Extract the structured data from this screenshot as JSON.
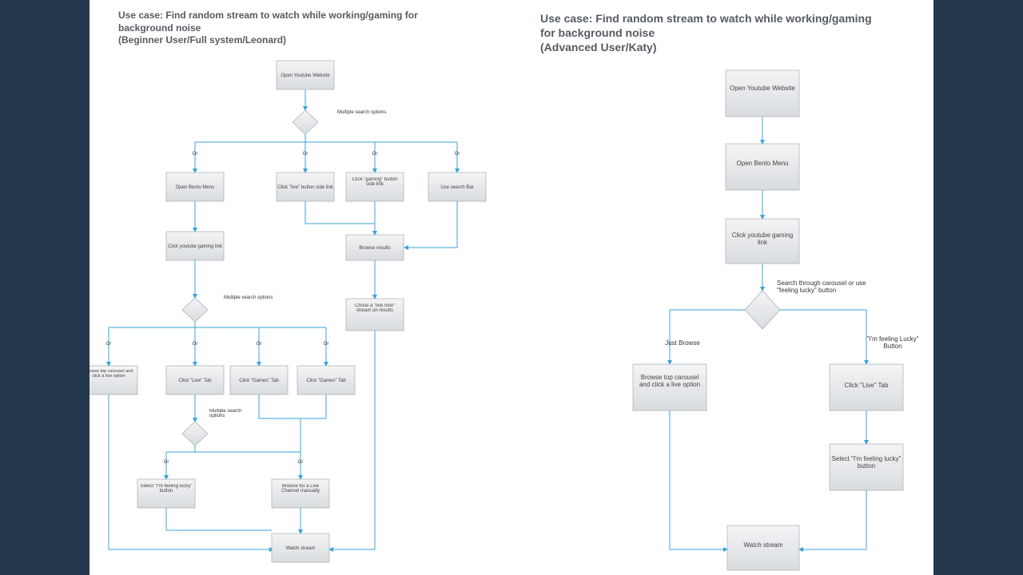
{
  "left": {
    "title": "Use case: Find random stream to watch while working/gaming for background noise\n(Beginner User/Full system/Leonard)",
    "nodes": {
      "n1": "Open Youtube Website",
      "dec1_label": "Multiple search options",
      "or": "Or",
      "b1": "Open Bento Menu",
      "b2": "Click \"live\" button side link",
      "b3": "Click \"gaming\" button side link",
      "b4": "Use search Bar",
      "n2": "Click youtube gaming link",
      "n3": "Browse results",
      "n4": "Chose a \"live now\" stream on results",
      "dec2_label": "Multiple search options",
      "c1": "Browse top carousel and click a live option",
      "c2": "Click \"Live\" Tab",
      "c3": "Click \"Games\" Tab",
      "c4": "Click \"Games\" Tab",
      "dec3_label": "Multiple search options",
      "d1": "Select \"I'm feeling lucky\" button",
      "d2": "Browse for a Live Channel manually",
      "nfinal": "Watch stream"
    }
  },
  "right": {
    "title": "Use case: Find random stream to watch while working/gaming for background noise\n(Advanced User/Katy)",
    "nodes": {
      "r1": "Open Youtube Website",
      "r2": "Open Bento Menu",
      "r3": "Click youtube gaming link",
      "dec_label": "Search through carousel or use \"feeling lucky\" button",
      "br1": "Just Browse",
      "br2": "\"I'm feeling Lucky\" Button",
      "r4": "Browse top carousel and click a live option",
      "r5": "Click \"Live\" Tab",
      "r6": "Select \"I'm feeling lucky\" button",
      "rfinal": "Watch stream"
    }
  }
}
